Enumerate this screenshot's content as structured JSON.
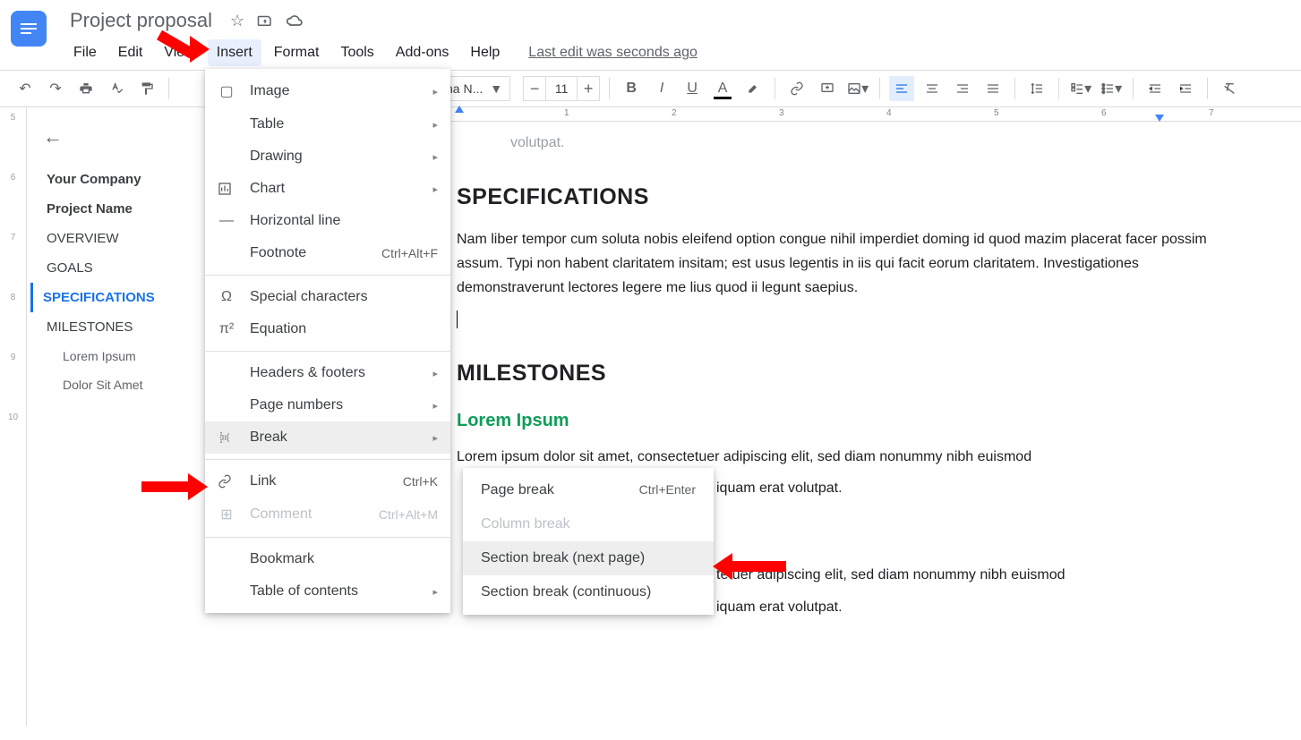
{
  "doc": {
    "title": "Project proposal",
    "last_edit": "Last edit was seconds ago"
  },
  "menus": {
    "file": "File",
    "edit": "Edit",
    "view": "View",
    "insert": "Insert",
    "format": "Format",
    "tools": "Tools",
    "addons": "Add-ons",
    "help": "Help"
  },
  "toolbar": {
    "font": "na N...",
    "size": "11"
  },
  "outline": {
    "items": [
      "Your Company",
      "Project Name",
      "OVERVIEW",
      "GOALS",
      "SPECIFICATIONS",
      "MILESTONES"
    ],
    "sub": [
      "Lorem Ipsum",
      "Dolor Sit Amet"
    ]
  },
  "doc_body": {
    "truncated": "volutpat.",
    "h_spec": "SPECIFICATIONS",
    "p_spec": "Nam liber tempor cum soluta nobis eleifend option congue nihil imperdiet doming id quod mazim placerat facer possim assum. Typi non habent claritatem insitam; est usus legentis in iis qui facit eorum claritatem. Investigationes demonstraverunt lectores legere me lius quod ii legunt saepius.",
    "h_mile": "MILESTONES",
    "h_lorem": "Lorem Ipsum",
    "p1": "Lorem ipsum dolor sit amet, consectetuer adipiscing elit, sed diam nonummy nibh euismod",
    "p1b": "iquam erat volutpat.",
    "p2": "tetuer adipiscing elit, sed diam nonummy nibh euismod",
    "p2b": "iquam erat volutpat."
  },
  "insert_menu": {
    "image": "Image",
    "table": "Table",
    "drawing": "Drawing",
    "chart": "Chart",
    "hr": "Horizontal line",
    "footnote": "Footnote",
    "footnote_sc": "Ctrl+Alt+F",
    "special": "Special characters",
    "equation": "Equation",
    "headers": "Headers & footers",
    "pagenum": "Page numbers",
    "break": "Break",
    "link": "Link",
    "link_sc": "Ctrl+K",
    "comment": "Comment",
    "comment_sc": "Ctrl+Alt+M",
    "bookmark": "Bookmark",
    "toc": "Table of contents"
  },
  "break_sub": {
    "page": "Page break",
    "page_sc": "Ctrl+Enter",
    "column": "Column break",
    "sec_next": "Section break (next page)",
    "sec_cont": "Section break (continuous)"
  },
  "ruler_marks": [
    "1",
    "2",
    "3",
    "4",
    "5",
    "6",
    "7"
  ]
}
